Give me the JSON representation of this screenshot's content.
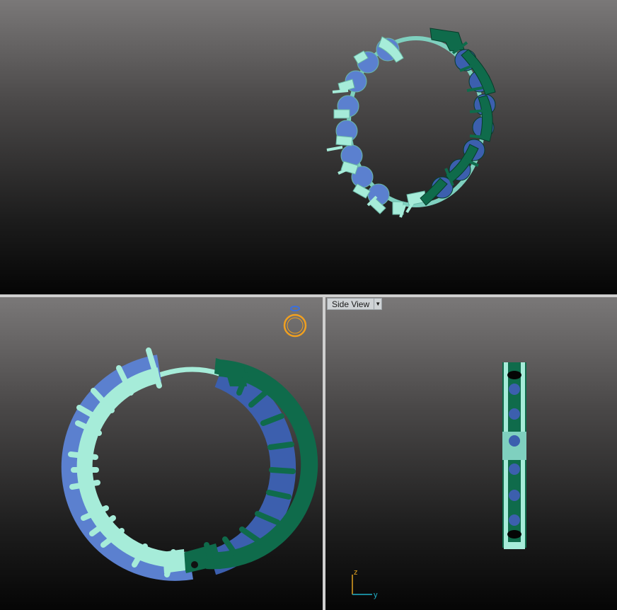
{
  "viewports": {
    "top": {
      "label": ""
    },
    "bottom_left": {
      "label": ""
    },
    "bottom_right": {
      "label": "Side View",
      "dropdown_icon": "chevron-down-icon"
    }
  },
  "axis_triad": {
    "vertical": "z",
    "horizontal": "y"
  },
  "colors": {
    "light_metal": "#a6ecd9",
    "dark_metal": "#0f6b4b",
    "gem": "#4c6fc4",
    "ring_icon": "#f0a020",
    "axis_z": "#e0a020",
    "axis_y": "#1fb0c8"
  },
  "icons": {
    "corner_widget": "ring-icon"
  }
}
